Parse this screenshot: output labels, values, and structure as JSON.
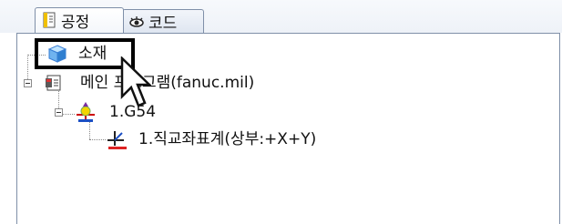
{
  "tabs": [
    {
      "label": "공정",
      "icon": "process-doc-icon",
      "active": true
    },
    {
      "label": "코드",
      "icon": "eye-icon",
      "active": false
    }
  ],
  "tree": {
    "material": {
      "label": "소재",
      "icon": "cube-icon"
    },
    "main_program": {
      "label": "메인 프로그램(fanuc.mil)",
      "icon": "program-icon"
    },
    "work_coord": {
      "label": "1.G54",
      "icon": "coordinate-icon"
    },
    "cartesian": {
      "label": "1.직교좌표계(상부:+X+Y)",
      "icon": "axis-icon"
    }
  },
  "colors": {
    "border": "#7f8fa8",
    "highlight": "#000000",
    "accent": "#3a7fd5"
  }
}
